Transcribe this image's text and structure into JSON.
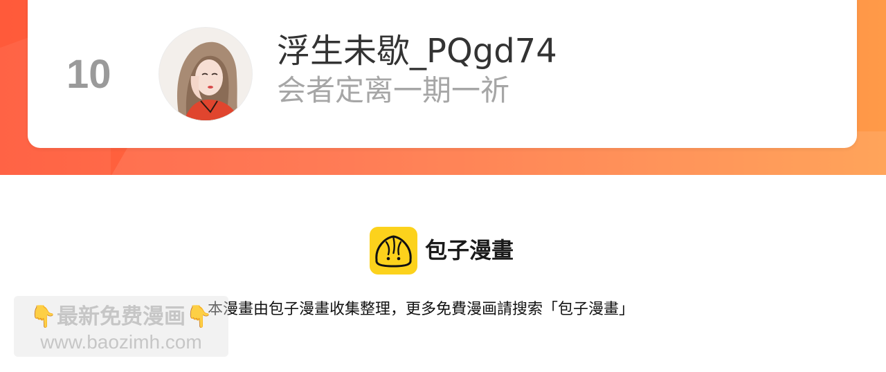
{
  "ranking": {
    "rank": "10",
    "user_name": "浮生未歇_PQgd74",
    "user_motto": "会者定离一期一祈"
  },
  "brand": {
    "name": "包子漫畫",
    "accent_color": "#fcd21c",
    "logo_icon": "steamed-bun-icon"
  },
  "notice": {
    "text": "本漫畫由包子漫畫收集整理，更多免費漫画請搜索「包子漫畫」"
  },
  "watermark": {
    "emoji_left": "👇",
    "title": "最新免费漫画",
    "emoji_right": "👇",
    "url": "www.baozimh.com"
  },
  "colors": {
    "band_start": "#ff5a3a",
    "band_end": "#ff9a48"
  }
}
